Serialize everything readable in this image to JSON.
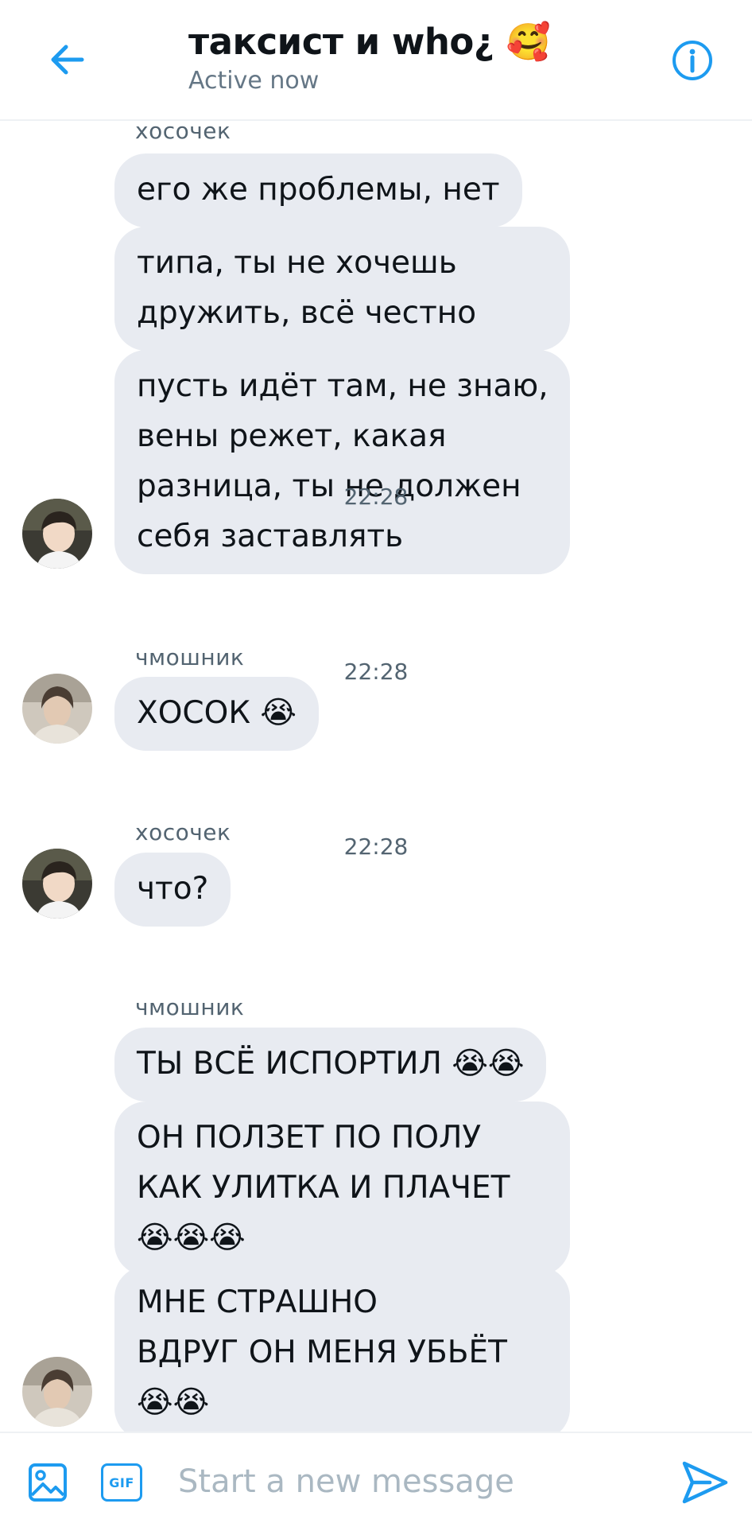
{
  "header": {
    "title": "таксист и who¿ 🥰",
    "status": "Active now",
    "accent_color": "#1d9bf0"
  },
  "messages": [
    {
      "sender": "хосочек",
      "bubbles": [
        [
          "его же проблемы, нет"
        ],
        [
          "типа, ты не хочешь",
          "дружить, всё честно"
        ],
        [
          "пусть идёт там, не знаю,",
          "вены режет, какая",
          "разница, ты не должен",
          "себя заставлять"
        ]
      ],
      "time": "22:28"
    },
    {
      "sender": "чмошник",
      "bubbles": [
        [
          "ХОСОК 😭"
        ]
      ],
      "time": "22:28"
    },
    {
      "sender": "хосочек",
      "bubbles": [
        [
          "что?"
        ]
      ],
      "time": "22:28"
    },
    {
      "sender": "чмошник",
      "bubbles": [
        [
          "ТЫ ВСЁ ИСПОРТИЛ 😭😭"
        ],
        [
          "ОН ПОЛЗЕТ ПО ПОЛУ",
          "КАК УЛИТКА И ПЛАЧЕТ",
          "😭😭😭"
        ],
        [
          "МНЕ СТРАШНО",
          "ВДРУГ ОН МЕНЯ УБЬЁТ",
          "😭😭"
        ]
      ]
    }
  ],
  "composer": {
    "placeholder": "Start a new message",
    "gif_label": "GIF"
  },
  "icons": {
    "back": "arrow-left-icon",
    "info": "info-icon",
    "media": "image-icon",
    "gif": "gif-icon",
    "send": "send-icon"
  }
}
